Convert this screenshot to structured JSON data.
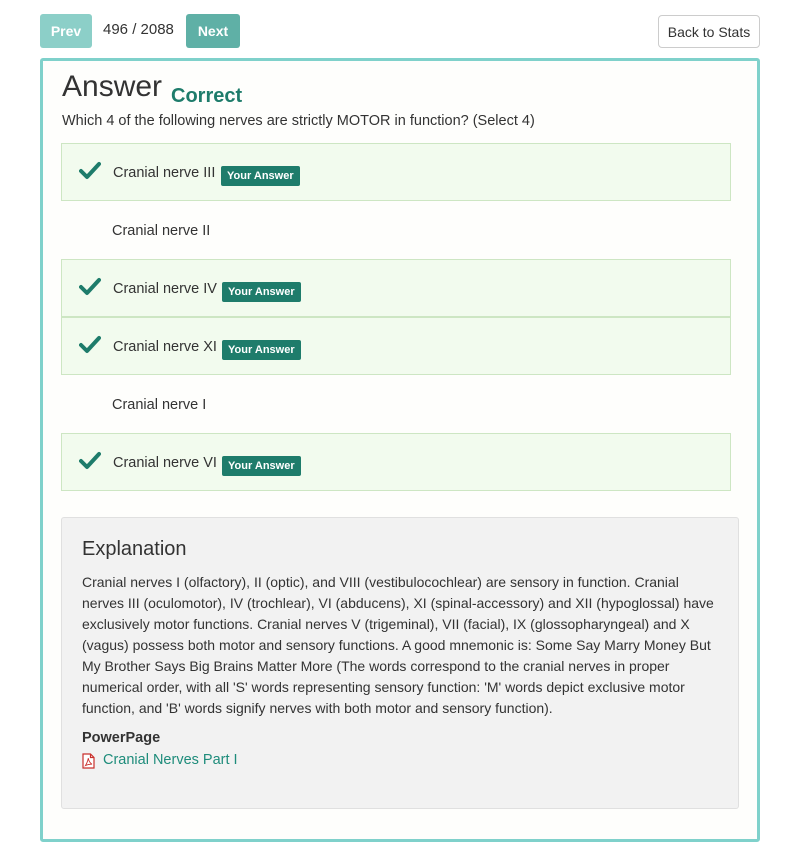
{
  "nav": {
    "prev_label": "Prev",
    "counter": "496 / 2088",
    "next_label": "Next",
    "back_label": "Back to Stats"
  },
  "result": {
    "title": "Answer",
    "status": "Correct",
    "question": "Which 4 of the following nerves are strictly MOTOR in function? (Select 4)"
  },
  "options": [
    {
      "label": "Cranial nerve III",
      "selected": true,
      "badge": "Your Answer"
    },
    {
      "label": "Cranial nerve II",
      "selected": false,
      "badge": ""
    },
    {
      "label": "Cranial nerve IV",
      "selected": true,
      "badge": "Your Answer"
    },
    {
      "label": "Cranial nerve XI",
      "selected": true,
      "badge": "Your Answer"
    },
    {
      "label": "Cranial nerve I",
      "selected": false,
      "badge": ""
    },
    {
      "label": "Cranial nerve VI",
      "selected": true,
      "badge": "Your Answer"
    }
  ],
  "explanation": {
    "heading": "Explanation",
    "text": "Cranial nerves I (olfactory), II (optic), and VIII (vestibulocochlear) are sensory in function. Cranial nerves III (oculomotor), IV (trochlear), VI (abducens), XI (spinal-accessory) and XII (hypoglossal) have exclusively motor functions. Cranial nerves V (trigeminal), VII (facial), IX (glossopharyngeal) and X (vagus) possess both motor and sensory functions. A good mnemonic is: Some Say Marry Money But My Brother Says Big Brains Matter More (The words correspond to the cranial nerves in proper numerical order, with all 'S' words representing sensory function: 'M' words depict exclusive motor function, and 'B' words signify nerves with both motor and sensory function).",
    "powerpage_label": "PowerPage",
    "link_label": "Cranial Nerves Part I",
    "link_icon": "pdf-icon"
  },
  "colors": {
    "accent": "#1e7c6b",
    "panel_border": "#7fd1cb",
    "selected_bg": "#f2fbee",
    "pdf_red": "#c9302c"
  }
}
